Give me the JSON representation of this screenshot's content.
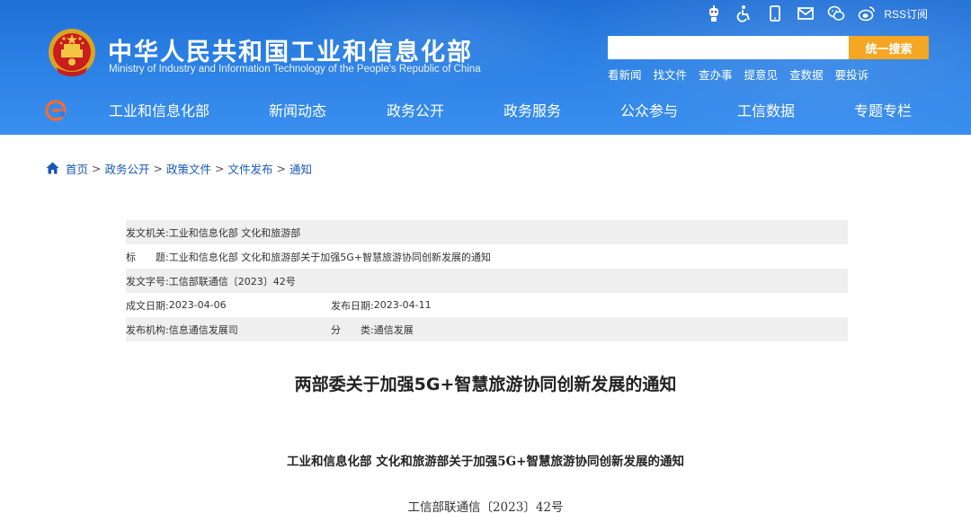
{
  "header": {
    "site_title_cn": "中华人民共和国工业和信息化部",
    "site_title_en": "Ministry of Industry and Information Technology of the People's Republic of China",
    "rss_label": "RSS订阅",
    "search": {
      "placeholder": "",
      "value": "",
      "button_label": "统一搜索"
    },
    "quick_links": [
      "看新闻",
      "找文件",
      "查办事",
      "提意见",
      "查数据",
      "要投诉"
    ],
    "nav": [
      "工业和信息化部",
      "新闻动态",
      "政务公开",
      "政务服务",
      "公众参与",
      "工信数据",
      "专题专栏"
    ],
    "colors": {
      "header_blue": "#2b80e4",
      "search_button": "#f5a623"
    }
  },
  "breadcrumb": [
    "首页",
    "政务公开",
    "政策文件",
    "文件发布",
    "通知"
  ],
  "breadcrumb_sep": ">",
  "meta": {
    "issuer_label": "发文机关:",
    "issuer_value": "工业和信息化部 文化和旅游部",
    "title_label": "标　　题:",
    "title_value": "工业和信息化部 文化和旅游部关于加强5G+智慧旅游协同创新发展的通知",
    "docno_label": "发文字号:",
    "docno_value": "工信部联通信〔2023〕42号",
    "made_date_label": "成文日期:",
    "made_date_value": "2023-04-06",
    "pub_date_label": "发布日期:",
    "pub_date_value": "2023-04-11",
    "org_label": "发布机构:",
    "org_value": "信息通信发展司",
    "category_label": "分　　类:",
    "category_value": "通信发展"
  },
  "article": {
    "title": "两部委关于加强5G+智慧旅游协同创新发展的通知",
    "subtitle": "工业和信息化部  文化和旅游部关于加强5G+智慧旅游协同创新发展的通知",
    "doc_number": "工信部联通信〔2023〕42号"
  }
}
